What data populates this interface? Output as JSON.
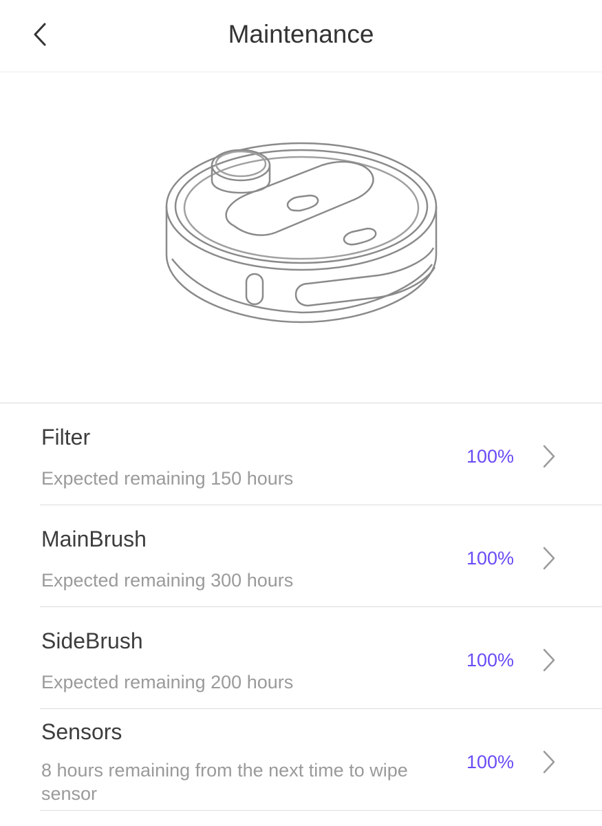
{
  "header": {
    "title": "Maintenance",
    "back_icon": "chevron-left-icon"
  },
  "hero": {
    "image": "robot-vacuum-illustration"
  },
  "colors": {
    "accent": "#6a4cf5",
    "secondary_text": "#9a9a9a",
    "primary_text": "#3d3d3d"
  },
  "items": [
    {
      "name": "Filter",
      "desc": "Expected remaining 150 hours",
      "percent": "100%"
    },
    {
      "name": "MainBrush",
      "desc": "Expected remaining 300 hours",
      "percent": "100%"
    },
    {
      "name": "SideBrush",
      "desc": "Expected remaining 200 hours",
      "percent": "100%"
    },
    {
      "name": "Sensors",
      "desc": "8 hours remaining from the next time to wipe sensor",
      "percent": "100%"
    }
  ]
}
